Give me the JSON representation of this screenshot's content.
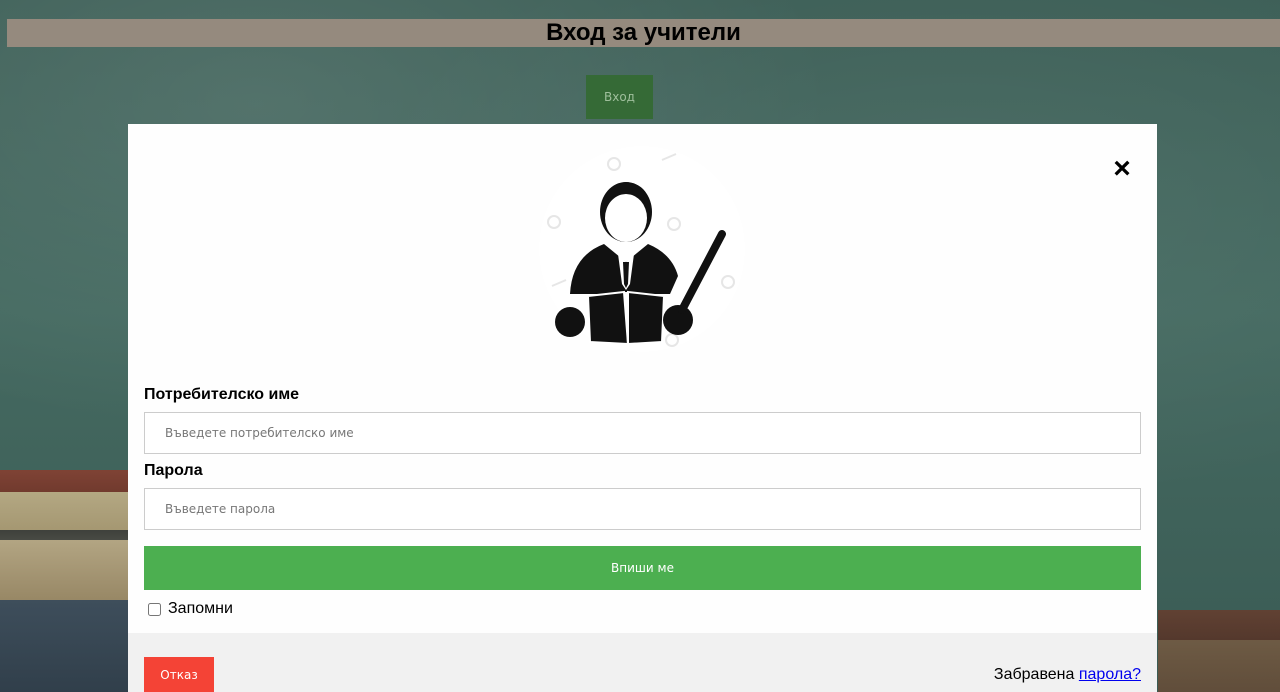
{
  "page": {
    "title": "Вход за учители",
    "open_button_label": "Вход"
  },
  "modal": {
    "close_symbol": "×",
    "avatar_icon": "teacher-icon",
    "username": {
      "label": "Потребителско име",
      "placeholder": "Въведете потребителско име",
      "value": ""
    },
    "password": {
      "label": "Парола",
      "placeholder": "Въведете парола",
      "value": ""
    },
    "submit_label": "Впиши ме",
    "remember_label": "Запомни",
    "remember_checked": false,
    "footer": {
      "cancel_label": "Отказ",
      "forgot_text": "Забравена",
      "forgot_link": "парола?"
    }
  },
  "colors": {
    "title_bar": "#958a7e",
    "open_button": "#356a36",
    "submit": "#4caf50",
    "cancel": "#f44336",
    "footer_bg": "#f1f1f1",
    "link": "#0000ee"
  }
}
